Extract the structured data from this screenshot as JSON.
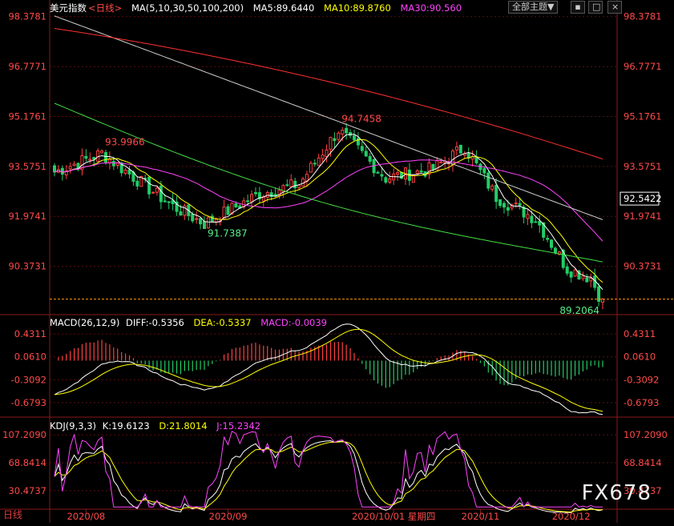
{
  "header": {
    "title": "美元指数",
    "period_tag": "<日线>",
    "ma_label": "MA(5,10,30,50,100,200)",
    "ma5": "MA5:89.6440",
    "ma10": "MA10:89.8760",
    "ma30": "MA30:90.560",
    "theme_button": "全部主题▼",
    "close_symbol": "×"
  },
  "macd_header": {
    "label": "MACD(26,12,9)",
    "diff": "DIFF:-0.5356",
    "dea": "DEA:-0.5337",
    "macd": "MACD:-0.0039"
  },
  "kdj_header": {
    "label": "KDJ(9,3,3)",
    "k": "K:19.6123",
    "d": "D:21.8014",
    "j": "J:15.2342"
  },
  "footer": {
    "period": "日线",
    "brand": "FX678"
  },
  "colors": {
    "up": "#ff4040",
    "down": "#22cc66",
    "ma5": "#ffffff",
    "ma10": "#ffff00",
    "ma30": "#ff44ff",
    "ma50": "#44dd44",
    "ma100": "#cccccc",
    "ma200": "#ff3030",
    "axis_text": "#ff4a4a",
    "grid": "#5a1010"
  },
  "chart_data": [
    {
      "type": "candlestick",
      "name": "price",
      "y_ticks": [
        "98.3781",
        "96.7771",
        "95.1761",
        "93.5751",
        "91.9741",
        "90.3731"
      ],
      "ylim": [
        88.9,
        98.5
      ],
      "x_ticks": [
        "2020/08",
        "2020/09",
        "2020/10/01 星期四",
        "2020/11",
        "2020/12"
      ],
      "last_price": "92.5422",
      "annotations": [
        "93.9966",
        "94.7458",
        "91.7387",
        "89.2064"
      ],
      "ma_values": {
        "MA5": 89.644,
        "MA10": 89.876,
        "MA30": 90.56
      }
    },
    {
      "type": "bar+line",
      "name": "MACD",
      "y_ticks": [
        "0.4311",
        "0.0610",
        "-0.3092",
        "-0.6793"
      ],
      "ylim": [
        -0.85,
        0.55
      ],
      "values": {
        "DIFF": -0.5356,
        "DEA": -0.5337,
        "MACD": -0.0039
      }
    },
    {
      "type": "line",
      "name": "KDJ",
      "y_ticks": [
        "107.2090",
        "68.8414",
        "30.4737"
      ],
      "ylim": [
        5,
        115
      ],
      "values": {
        "K": 19.6123,
        "D": 21.8014,
        "J": 15.2342
      }
    }
  ]
}
